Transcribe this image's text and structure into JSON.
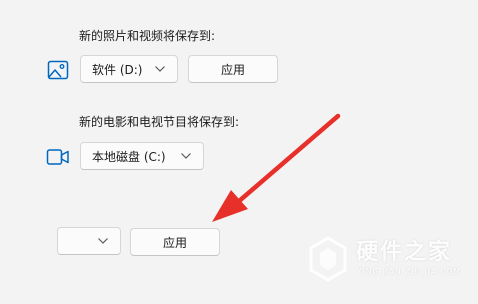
{
  "photos_section": {
    "label": "新的照片和视频将保存到:",
    "icon": "image-icon",
    "drive_value": "软件 (D:)",
    "apply_label": "应用"
  },
  "movies_section": {
    "label": "新的电影和电视节目将保存到:",
    "icon": "video-camera-icon",
    "drive_value": "本地磁盘 (C:)"
  },
  "bottom_row": {
    "drive_value": "",
    "apply_label": "应用"
  },
  "annotation": {
    "arrow_color": "#e8302a"
  },
  "watermark": {
    "title": "硬件之家",
    "subtitle": "YING JIAN ZHI JIA.COM"
  },
  "colors": {
    "accent": "#0067c0",
    "background": "#f3f3f3"
  }
}
